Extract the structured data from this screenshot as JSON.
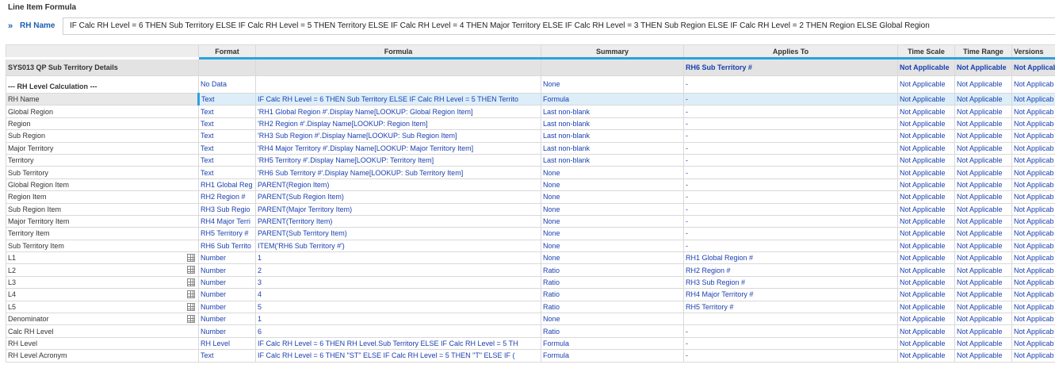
{
  "header": {
    "title": "Line Item Formula",
    "line_item_name": "RH Name",
    "formula": "IF Calc RH Level = 6 THEN Sub Territory ELSE IF Calc RH Level = 5 THEN Territory ELSE IF Calc RH Level = 4 THEN Major Territory ELSE IF Calc RH Level = 3 THEN Sub Region ELSE IF Calc RH Level = 2 THEN Region ELSE Global Region"
  },
  "columns": [
    "Format",
    "Formula",
    "Summary",
    "Applies To",
    "Time Scale",
    "Time Range",
    "Versions"
  ],
  "module": {
    "name": "SYS013 QP Sub Territory Details",
    "format": "",
    "formula": "",
    "summary": "",
    "applies_to": "RH6 Sub Territory #",
    "time_scale": "Not Applicable",
    "time_range": "Not Applicable",
    "versions": "Not Applicab"
  },
  "section": {
    "name": "--- RH Level Calculation ---",
    "format": "No Data",
    "formula": "",
    "summary": "None",
    "applies_to": "-",
    "time_scale": "Not Applicable",
    "time_range": "Not Applicable",
    "versions": "Not Applicab"
  },
  "rows": [
    {
      "name": "RH Name",
      "format": "Text",
      "formula": "IF Calc RH Level = 6 THEN Sub Territory ELSE IF Calc RH Level = 5 THEN Territo",
      "summary": "Formula",
      "applies_to": "-",
      "time_scale": "Not Applicable",
      "time_range": "Not Applicable",
      "versions": "Not Applicab",
      "selected": true,
      "icon": ""
    },
    {
      "name": "Global Region",
      "format": "Text",
      "formula": "'RH1 Global Region #'.Display Name[LOOKUP: Global Region Item]",
      "summary": "Last non-blank",
      "applies_to": "-",
      "time_scale": "Not Applicable",
      "time_range": "Not Applicable",
      "versions": "Not Applicab",
      "icon": ""
    },
    {
      "name": "Region",
      "format": "Text",
      "formula": "'RH2 Region #'.Display Name[LOOKUP: Region Item]",
      "summary": "Last non-blank",
      "applies_to": "-",
      "time_scale": "Not Applicable",
      "time_range": "Not Applicable",
      "versions": "Not Applicab",
      "icon": ""
    },
    {
      "name": "Sub Region",
      "format": "Text",
      "formula": "'RH3 Sub Region #'.Display Name[LOOKUP: Sub Region Item]",
      "summary": "Last non-blank",
      "applies_to": "-",
      "time_scale": "Not Applicable",
      "time_range": "Not Applicable",
      "versions": "Not Applicab",
      "icon": ""
    },
    {
      "name": "Major Territory",
      "format": "Text",
      "formula": "'RH4 Major Territory #'.Display Name[LOOKUP: Major Territory Item]",
      "summary": "Last non-blank",
      "applies_to": "-",
      "time_scale": "Not Applicable",
      "time_range": "Not Applicable",
      "versions": "Not Applicab",
      "icon": ""
    },
    {
      "name": "Territory",
      "format": "Text",
      "formula": "'RH5 Territory #'.Display Name[LOOKUP: Territory Item]",
      "summary": "Last non-blank",
      "applies_to": "-",
      "time_scale": "Not Applicable",
      "time_range": "Not Applicable",
      "versions": "Not Applicab",
      "icon": ""
    },
    {
      "name": "Sub Territory",
      "format": "Text",
      "formula": "'RH6 Sub Territory #'.Display Name[LOOKUP: Sub Territory Item]",
      "summary": "None",
      "applies_to": "-",
      "time_scale": "Not Applicable",
      "time_range": "Not Applicable",
      "versions": "Not Applicab",
      "icon": ""
    },
    {
      "name": "Global Region Item",
      "format": "RH1 Global Reg",
      "formula": "PARENT(Region Item)",
      "summary": "None",
      "applies_to": "-",
      "time_scale": "Not Applicable",
      "time_range": "Not Applicable",
      "versions": "Not Applicab",
      "icon": ""
    },
    {
      "name": "Region Item",
      "format": "RH2 Region #",
      "formula": "PARENT(Sub Region Item)",
      "summary": "None",
      "applies_to": "-",
      "time_scale": "Not Applicable",
      "time_range": "Not Applicable",
      "versions": "Not Applicab",
      "icon": ""
    },
    {
      "name": "Sub Region Item",
      "format": "RH3 Sub Regio",
      "formula": "PARENT(Major Territory Item)",
      "summary": "None",
      "applies_to": "-",
      "time_scale": "Not Applicable",
      "time_range": "Not Applicable",
      "versions": "Not Applicab",
      "icon": ""
    },
    {
      "name": "Major Territory Item",
      "format": "RH4 Major Terri",
      "formula": "PARENT(Territory Item)",
      "summary": "None",
      "applies_to": "-",
      "time_scale": "Not Applicable",
      "time_range": "Not Applicable",
      "versions": "Not Applicab",
      "icon": ""
    },
    {
      "name": "Territory Item",
      "format": "RH5 Territory #",
      "formula": "PARENT(Sub Territory Item)",
      "summary": "None",
      "applies_to": "-",
      "time_scale": "Not Applicable",
      "time_range": "Not Applicable",
      "versions": "Not Applicab",
      "icon": ""
    },
    {
      "name": "Sub Territory Item",
      "format": "RH6 Sub Territo",
      "formula": "ITEM('RH6 Sub Territory #')",
      "summary": "None",
      "applies_to": "-",
      "time_scale": "Not Applicable",
      "time_range": "Not Applicable",
      "versions": "Not Applicab",
      "icon": ""
    },
    {
      "name": "L1",
      "format": "Number",
      "formula": "1",
      "summary": "None",
      "applies_to": "RH1 Global Region #",
      "time_scale": "Not Applicable",
      "time_range": "Not Applicable",
      "versions": "Not Applicab",
      "icon": "grid-icon"
    },
    {
      "name": "L2",
      "format": "Number",
      "formula": "2",
      "summary": "Ratio",
      "applies_to": "RH2 Region #",
      "time_scale": "Not Applicable",
      "time_range": "Not Applicable",
      "versions": "Not Applicab",
      "icon": "grid-icon"
    },
    {
      "name": "L3",
      "format": "Number",
      "formula": "3",
      "summary": "Ratio",
      "applies_to": "RH3 Sub Region #",
      "time_scale": "Not Applicable",
      "time_range": "Not Applicable",
      "versions": "Not Applicab",
      "icon": "grid-icon"
    },
    {
      "name": "L4",
      "format": "Number",
      "formula": "4",
      "summary": "Ratio",
      "applies_to": "RH4 Major Territory #",
      "time_scale": "Not Applicable",
      "time_range": "Not Applicable",
      "versions": "Not Applicab",
      "icon": "grid-icon"
    },
    {
      "name": "L5",
      "format": "Number",
      "formula": "5",
      "summary": "Ratio",
      "applies_to": "RH5 Territory #",
      "time_scale": "Not Applicable",
      "time_range": "Not Applicable",
      "versions": "Not Applicab",
      "icon": "grid-icon"
    },
    {
      "name": "Denominator",
      "format": "Number",
      "formula": "1",
      "summary": "None",
      "applies_to": "",
      "time_scale": "Not Applicable",
      "time_range": "Not Applicable",
      "versions": "Not Applicab",
      "icon": "grid-icon"
    },
    {
      "name": "Calc RH Level",
      "format": "Number",
      "formula": "6",
      "summary": "Ratio",
      "applies_to": "-",
      "time_scale": "Not Applicable",
      "time_range": "Not Applicable",
      "versions": "Not Applicab",
      "icon": ""
    },
    {
      "name": "RH Level",
      "format": "RH Level",
      "formula": "IF Calc RH Level = 6 THEN RH Level.Sub Territory ELSE IF Calc RH Level = 5 TH",
      "summary": "Formula",
      "applies_to": "-",
      "time_scale": "Not Applicable",
      "time_range": "Not Applicable",
      "versions": "Not Applicab",
      "icon": ""
    },
    {
      "name": "RH Level Acronym",
      "format": "Text",
      "formula": "IF Calc RH Level = 6 THEN \"ST\" ELSE IF Calc RH Level = 5 THEN \"T\" ELSE IF (",
      "summary": "Formula",
      "applies_to": "-",
      "time_scale": "Not Applicable",
      "time_range": "Not Applicable",
      "versions": "Not Applicab",
      "icon": ""
    }
  ],
  "colors": {
    "accent": "#2ba3e0",
    "link": "#1a3fb0",
    "section_bg": "#e3e3e3",
    "selected_bg": "#ddeef9"
  }
}
